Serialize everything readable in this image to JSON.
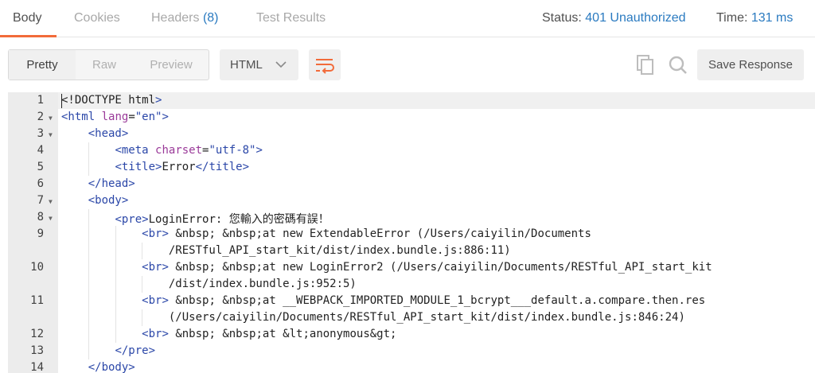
{
  "tabs": [
    {
      "label": "Body",
      "active": true
    },
    {
      "label": "Cookies"
    },
    {
      "label": "Headers",
      "count": "(8)"
    },
    {
      "label": "Test Results"
    }
  ],
  "status": {
    "label": "Status:",
    "value": "401 Unauthorized"
  },
  "time": {
    "label": "Time:",
    "value": "131 ms"
  },
  "view_modes": [
    "Pretty",
    "Raw",
    "Preview"
  ],
  "format": {
    "selected": "HTML"
  },
  "toolbar": {
    "save_label": "Save Response"
  },
  "colors": {
    "accent": "#f26b3a",
    "link": "#2a7ac0",
    "tag": "#2b47a8",
    "attr": "#9a3a99"
  },
  "icons": {
    "copy": "copy-icon",
    "search": "search-icon",
    "wrap": "wrap-lines-icon",
    "chevron": "chevron-down-icon"
  },
  "code_lines": [
    {
      "n": "1",
      "fold": false,
      "rows": [
        "<!DOCTYPE html>"
      ]
    },
    {
      "n": "2",
      "fold": true,
      "rows": [
        "<html lang=\"en\">"
      ]
    },
    {
      "n": "3",
      "fold": true,
      "rows": [
        "    <head>"
      ]
    },
    {
      "n": "4",
      "fold": false,
      "rows": [
        "        <meta charset=\"utf-8\">"
      ]
    },
    {
      "n": "5",
      "fold": false,
      "rows": [
        "        <title>Error</title>"
      ]
    },
    {
      "n": "6",
      "fold": false,
      "rows": [
        "    </head>"
      ]
    },
    {
      "n": "7",
      "fold": true,
      "rows": [
        "    <body>"
      ]
    },
    {
      "n": "8",
      "fold": true,
      "rows": [
        "        <pre>LoginError: 您輸入的密碼有誤！"
      ]
    },
    {
      "n": "9",
      "fold": false,
      "rows": [
        "            <br> &nbsp; &nbsp;at new ExtendableError (/Users/caiyilin/Documents",
        "                /RESTful_API_start_kit/dist/index.bundle.js:886:11)"
      ]
    },
    {
      "n": "10",
      "fold": false,
      "rows": [
        "            <br> &nbsp; &nbsp;at new LoginError2 (/Users/caiyilin/Documents/RESTful_API_start_kit",
        "                /dist/index.bundle.js:952:5)"
      ]
    },
    {
      "n": "11",
      "fold": false,
      "rows": [
        "            <br> &nbsp; &nbsp;at __WEBPACK_IMPORTED_MODULE_1_bcrypt___default.a.compare.then.res",
        "                (/Users/caiyilin/Documents/RESTful_API_start_kit/dist/index.bundle.js:846:24)"
      ]
    },
    {
      "n": "12",
      "fold": false,
      "rows": [
        "            <br> &nbsp; &nbsp;at &lt;anonymous&gt;"
      ]
    },
    {
      "n": "13",
      "fold": false,
      "rows": [
        "        </pre>"
      ]
    },
    {
      "n": "14",
      "fold": false,
      "rows": [
        "    </body>"
      ]
    }
  ]
}
